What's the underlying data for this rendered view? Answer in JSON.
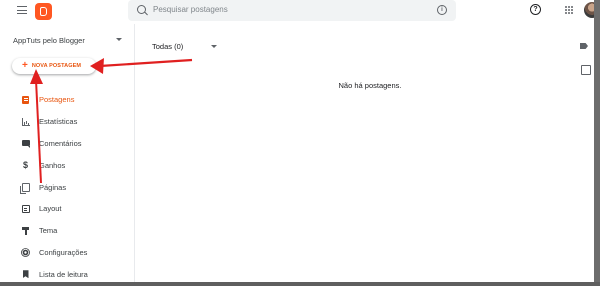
{
  "search": {
    "placeholder": "Pesquisar postagens"
  },
  "sidebar": {
    "blog_name": "AppTuts pelo Blogger",
    "new_post_label": "NOVA POSTAGEM",
    "items": [
      {
        "label": "Postagens",
        "icon": "posts-icon",
        "active": true
      },
      {
        "label": "Estatísticas",
        "icon": "stats-icon"
      },
      {
        "label": "Comentários",
        "icon": "comments-icon"
      },
      {
        "label": "Ganhos",
        "icon": "dollar-icon"
      },
      {
        "label": "Páginas",
        "icon": "pages-icon"
      },
      {
        "label": "Layout",
        "icon": "layout-icon"
      },
      {
        "label": "Tema",
        "icon": "theme-icon"
      },
      {
        "label": "Configurações",
        "icon": "gear-icon"
      },
      {
        "label": "Lista de leitura",
        "icon": "bookmark-icon"
      }
    ]
  },
  "main": {
    "filter_label": "Todas (0)",
    "empty_message": "Não há postagens."
  },
  "colors": {
    "accent": "#ff5722",
    "annotation": "#e02020"
  }
}
